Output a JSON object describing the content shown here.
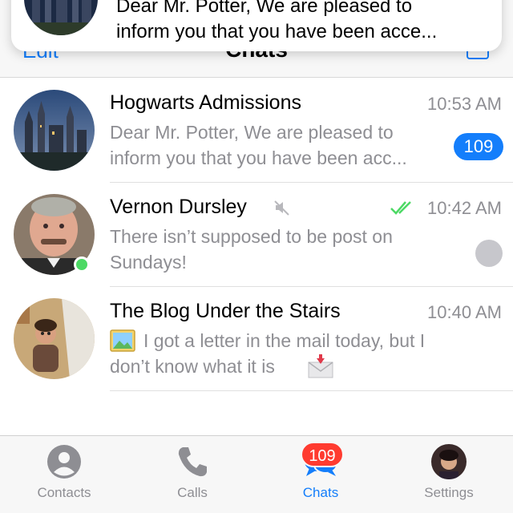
{
  "navbar": {
    "edit_label": "Edit",
    "title": "Chats"
  },
  "notification": {
    "line1": "Dear Mr. Potter, We are pleased to",
    "line2": "inform you that you have been acce..."
  },
  "chats": [
    {
      "name": "Hogwarts Admissions",
      "time": "10:53 AM",
      "preview_line1": "Dear Mr. Potter, We are pleased to",
      "preview_line2": "inform you that you have been acc...",
      "unread": "109"
    },
    {
      "name": "Vernon Dursley",
      "time": "10:42 AM",
      "preview_line1": "There isn’t supposed to be post on",
      "preview_line2": "Sundays!",
      "muted": true,
      "read_status": "double-check-icon",
      "online": true
    },
    {
      "name": "The Blog Under the Stairs",
      "time": "10:40 AM",
      "preview_line1": "I got a letter in the mail today, but I",
      "preview_line2": "don’t know what it is",
      "attachment_icon": "photo-icon",
      "trailing_icon": "envelope-icon"
    }
  ],
  "tabbar": {
    "tabs": [
      {
        "label": "Contacts",
        "icon": "person-icon"
      },
      {
        "label": "Calls",
        "icon": "phone-icon"
      },
      {
        "label": "Chats",
        "icon": "chat-bubbles-icon",
        "badge": "109",
        "active": true
      },
      {
        "label": "Settings",
        "icon": "profile-avatar-icon"
      }
    ]
  },
  "colors": {
    "accent": "#147efb",
    "badge_red": "#ff3b30",
    "online_green": "#4cd964",
    "read_check_green": "#4cd964",
    "muted_badge_gray": "#c7c7cc"
  }
}
